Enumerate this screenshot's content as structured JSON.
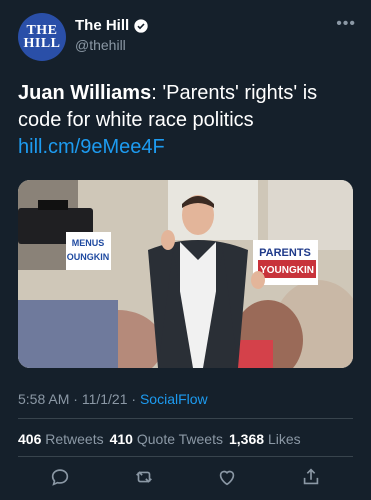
{
  "account": {
    "avatar_text": [
      "THE",
      "HILL"
    ],
    "display_name": "The Hill",
    "handle": "@thehill"
  },
  "tweet": {
    "author_bold": "Juan Williams",
    "text": ": 'Parents' rights' is code for white race politics ",
    "link": "hill.cm/9eMee4F"
  },
  "image_signs": {
    "sign_left": "MENUS\nOUNGKIN",
    "sign_right": "PARENTS\nYOUNGKIN"
  },
  "meta": {
    "time": "5:58 AM",
    "date": "11/1/21",
    "separator": "·",
    "source": "SocialFlow"
  },
  "stats": {
    "retweets_count": "406",
    "retweets_label": "Retweets",
    "quotes_count": "410",
    "quotes_label": "Quote Tweets",
    "likes_count": "1,368",
    "likes_label": "Likes"
  },
  "colors": {
    "background": "#15202b",
    "link": "#1d9bf0",
    "muted": "#8b98a5",
    "divider": "#38444d"
  }
}
